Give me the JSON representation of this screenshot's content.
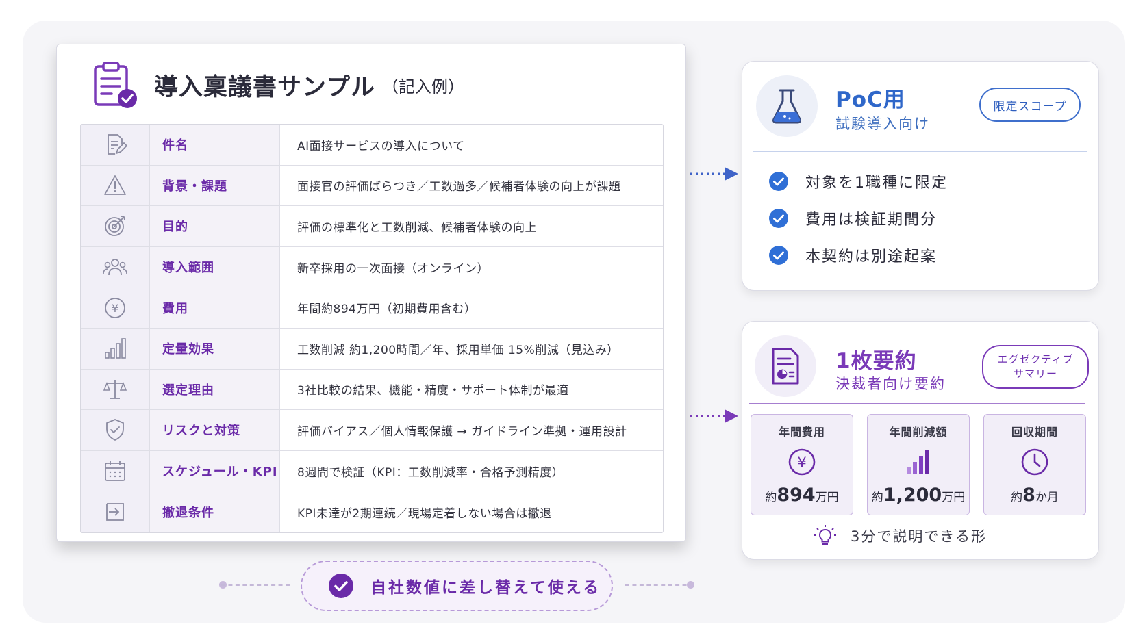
{
  "document": {
    "title": "導入稟議書サンプル",
    "title_note": "（記入例）",
    "rows": [
      {
        "icon": "edit-document-icon",
        "label": "件名",
        "value": "AI面接サービスの導入について"
      },
      {
        "icon": "warning-icon",
        "label": "背景・課題",
        "value": "面接官の評価ばらつき／工数過多／候補者体験の向上が課題"
      },
      {
        "icon": "target-icon",
        "label": "目的",
        "value": "評価の標準化と工数削減、候補者体験の向上"
      },
      {
        "icon": "people-icon",
        "label": "導入範囲",
        "value": "新卒採用の一次面接（オンライン）"
      },
      {
        "icon": "yen-icon",
        "label": "費用",
        "value": "年間約894万円（初期費用含む）"
      },
      {
        "icon": "bar-chart-icon",
        "label": "定量効果",
        "value": "工数削減 約1,200時間／年、採用単価 15%削減（見込み）"
      },
      {
        "icon": "scale-icon",
        "label": "選定理由",
        "value": "3社比較の結果、機能・精度・サポート体制が最適"
      },
      {
        "icon": "shield-check-icon",
        "label": "リスクと対策",
        "value": "評価バイアス／個人情報保護 → ガイドライン準拠・運用設計"
      },
      {
        "icon": "calendar-icon",
        "label": "スケジュール・KPI",
        "value": "8週間で検証（KPI：工数削減率・合格予測精度）"
      },
      {
        "icon": "exit-icon",
        "label": "撤退条件",
        "value": "KPI未達が2期連続／現場定着しない場合は撤退"
      }
    ]
  },
  "poc": {
    "icon": "flask-icon",
    "title": "PoC用",
    "subtitle": "試験導入向け",
    "badge": "限定スコープ",
    "checks": [
      "対象を1職種に限定",
      "費用は検証期間分",
      "本契約は別途起案"
    ]
  },
  "summary": {
    "icon": "report-icon",
    "title": "1枚要約",
    "subtitle": "決裁者向け要約",
    "badge_line1": "エグゼクティブ",
    "badge_line2": "サマリー",
    "metrics": [
      {
        "label": "年間費用",
        "icon": "yen-icon",
        "prefix": "約",
        "value": "894",
        "unit": "万円"
      },
      {
        "label": "年間削減額",
        "icon": "bar-chart-icon",
        "prefix": "約",
        "value": "1,200",
        "unit": "万円"
      },
      {
        "label": "回収期間",
        "icon": "clock-icon",
        "prefix": "約",
        "value": "8",
        "unit": "か月"
      }
    ],
    "tip": "3分で説明できる形"
  },
  "cta": {
    "label": "自社数値に差し替えて使える"
  },
  "colors": {
    "purple": "#6a2aa8",
    "blue": "#2f67c9",
    "check_blue": "#2f6fd6"
  }
}
